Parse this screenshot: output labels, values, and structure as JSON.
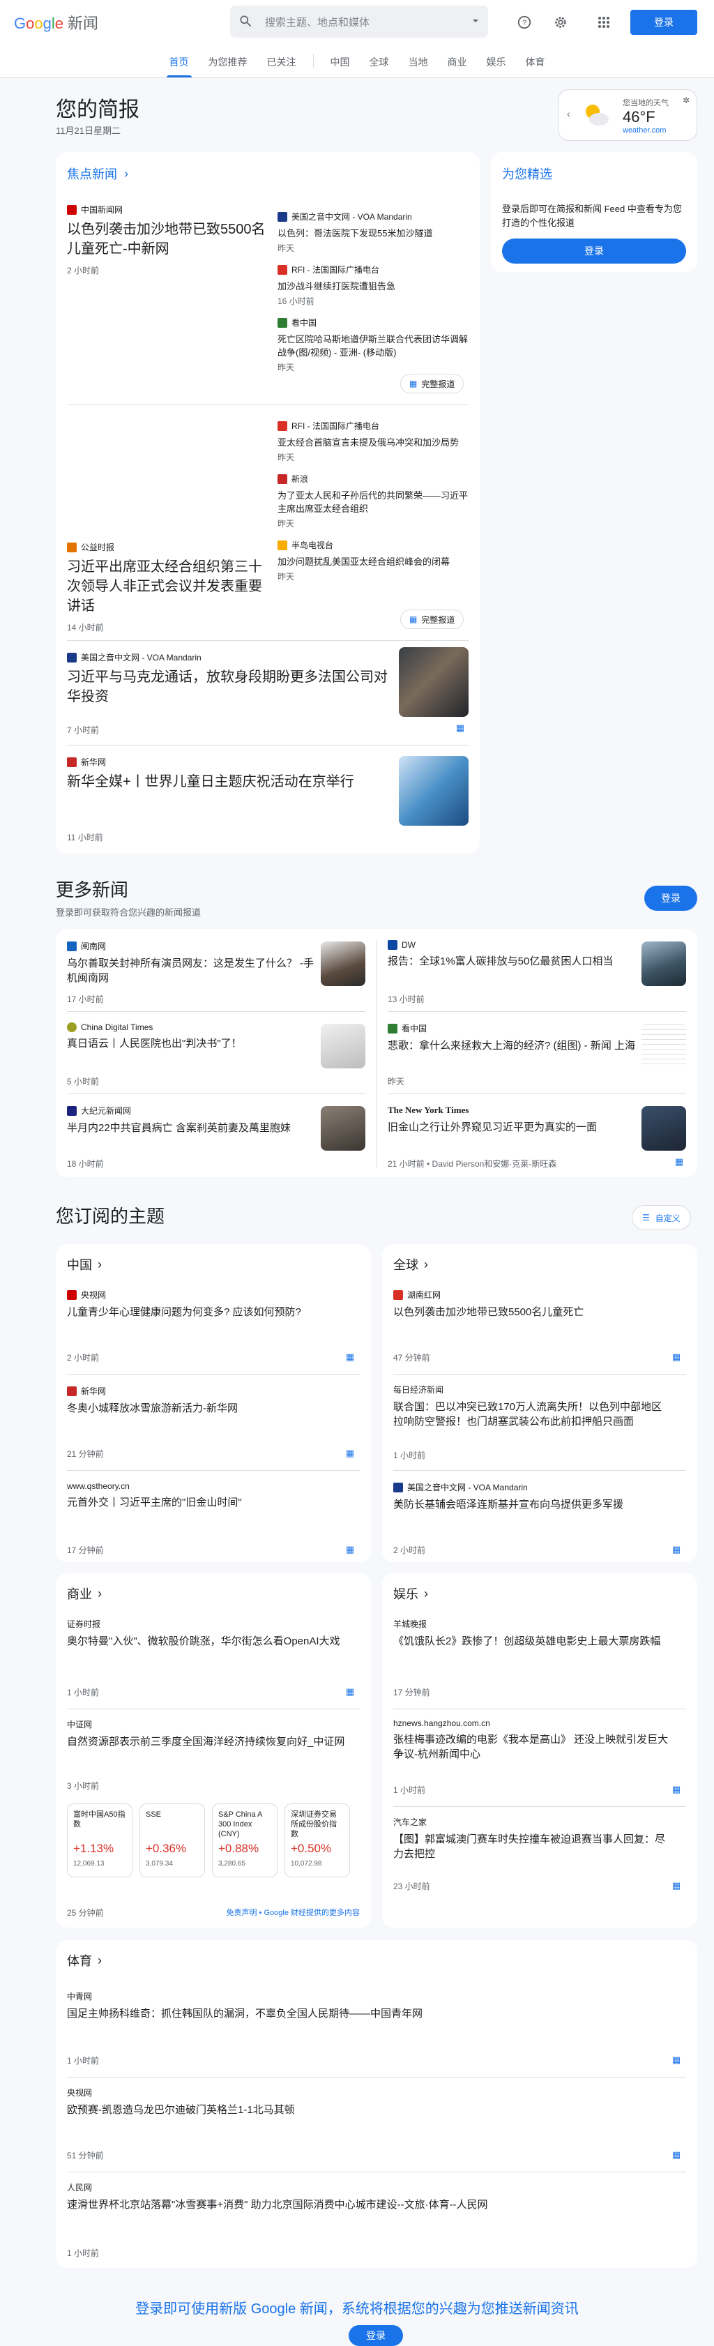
{
  "header": {
    "logo_word": "Google",
    "logo_suffix": "新闻",
    "search_placeholder": "搜索主题、地点和媒体",
    "login": "登录"
  },
  "nav": {
    "tabs": [
      "首页",
      "为您推荐",
      "已关注",
      "中国",
      "全球",
      "当地",
      "商业",
      "娱乐",
      "体育"
    ]
  },
  "briefing": {
    "title": "您的简报",
    "date": "11月21日星期二",
    "weather_label": "您当地的天气",
    "temp": "46°F",
    "weather_src": "weather.com"
  },
  "top": {
    "heading": "焦点新闻",
    "full_coverage": "完整报道",
    "c1": {
      "src": "中国新闻网",
      "title": "以色列袭击加沙地带已致5500名儿童死亡-中新网",
      "time": "2 小时前",
      "side": [
        {
          "src": "美国之音中文网 - VOA Mandarin",
          "title": "以色列：哥法医院下发现55米加沙隧道",
          "time": "昨天"
        },
        {
          "src": "RFI - 法国国际广播电台",
          "title": "加沙战斗继续打医院遭狙告急",
          "time": "16 小时前"
        },
        {
          "src": "看中国",
          "title": "死亡区院哈马斯地道伊斯兰联合代表团访华调解战争(图/视频) - 亚洲- (移动版)",
          "time": "昨天"
        }
      ]
    },
    "c2": {
      "src": "公益时报",
      "title": "习近平出席亚太经合组织第三十次领导人非正式会议并发表重要讲话",
      "time": "14 小时前",
      "side": [
        {
          "src": "RFI - 法国国际广播电台",
          "title": "亚太经合首脑宣言未提及俄乌冲突和加沙局势",
          "time": "昨天"
        },
        {
          "src": "新浪",
          "title": "为了亚太人民和子孙后代的共同繁荣——习近平主席出席亚太经合组织",
          "time": "昨天"
        },
        {
          "src": "半岛电视台",
          "title": "加沙问题扰乱美国亚太经合组织峰会的闭幕",
          "time": "昨天"
        }
      ]
    },
    "c3": {
      "src": "美国之音中文网 - VOA Mandarin",
      "title": "习近平与马克龙通话，放软身段期盼更多法国公司对华投资",
      "time": "7 小时前"
    },
    "c4": {
      "src": "新华网",
      "title": "新华全媒+丨世界儿童日主题庆祝活动在京举行",
      "time": "11 小时前"
    }
  },
  "picks": {
    "heading": "为您精选",
    "text": "登录后即可在简报和新闻 Feed 中查看专为您打造的个性化报道",
    "login": "登录"
  },
  "more": {
    "title": "更多新闻",
    "sub": "登录即可获取符合您兴趣的新闻报道",
    "login": "登录",
    "items": [
      {
        "src": "闽南网",
        "title": "乌尔善取关封神所有演员网友：这是发生了什么？ -手机闽南网",
        "time": "17 小时前"
      },
      {
        "src": "DW",
        "title": "报告：全球1%富人碳排放与50亿最贫困人口相当",
        "time": "13 小时前"
      },
      {
        "src": "China Digital Times",
        "title": "真日语云丨人民医院也出\"判决书\"了！",
        "time": "5 小时前"
      },
      {
        "src": "看中国",
        "title": "悲歌：拿什么来拯救大上海的经济? (组图) - 新闻 上海",
        "time": "昨天"
      },
      {
        "src": "大纪元新闻网",
        "title": "半月内22中共官員病亡 含案刹英前妻及萬里胞妹",
        "time": "18 小时前"
      },
      {
        "src": "The New York Times",
        "title": "旧金山之行让外界窥见习近平更为真实的一面",
        "time": "21 小时前 • David Pierson和安娜·克莱-斯旺森"
      }
    ]
  },
  "topics": {
    "title": "您订阅的主题",
    "customize": "自定义",
    "china": {
      "name": "中国",
      "items": [
        {
          "src": "央视网",
          "title": "儿童青少年心理健康问题为何变多? 应该如何预防?",
          "time": "2 小时前"
        },
        {
          "src": "新华网",
          "title": "冬奥小城释放冰雪旅游新活力-新华网",
          "time": "21 分钟前"
        },
        {
          "src": "www.qstheory.cn",
          "title": "元首外交丨习近平主席的\"旧金山时间\"",
          "time": "17 分钟前"
        }
      ]
    },
    "world": {
      "name": "全球",
      "items": [
        {
          "src": "湖南红网",
          "title": "以色列袭击加沙地带已致5500名儿童死亡",
          "time": "47 分钟前"
        },
        {
          "src": "每日经济新闻",
          "title": "联合国：巴以冲突已致170万人流离失所！以色列中部地区拉响防空警报！也门胡塞武装公布此前扣押船只画面",
          "time": "1 小时前"
        },
        {
          "src": "美国之音中文网 - VOA Mandarin",
          "title": "美防长基辅会晤泽连斯基并宣布向乌提供更多军援",
          "time": "2 小时前"
        }
      ]
    },
    "biz": {
      "name": "商业",
      "items": [
        {
          "src": "证券时报",
          "title": "奥尔特曼\"入伙\"、微软股价跳涨，华尔街怎么看OpenAI大戏",
          "time": "1 小时前"
        },
        {
          "src": "中证网",
          "title": "自然资源部表示前三季度全国海洋经济持续恢复向好_中证网",
          "time": "3 小时前"
        }
      ],
      "stocks": [
        {
          "name": "富时中国A50指数",
          "pct": "+1.13%",
          "val": "12,069.13"
        },
        {
          "name": "SSE",
          "pct": "+0.36%",
          "val": "3,079.34"
        },
        {
          "name": "S&P China A 300 Index (CNY)",
          "pct": "+0.88%",
          "val": "3,280.65"
        },
        {
          "name": "深圳证券交易所成份股价指数",
          "pct": "+0.50%",
          "val": "10,072.98"
        }
      ],
      "stock_time": "25 分钟前",
      "disclaimer": "免责声明 • Google 财经提供的更多内容"
    },
    "ent": {
      "name": "娱乐",
      "items": [
        {
          "src": "羊城晚报",
          "title": "《饥饿队长2》跌惨了！创超级英雄电影史上最大票房跌幅",
          "time": "17 分钟前"
        },
        {
          "src": "hznews.hangzhou.com.cn",
          "title": "张桂梅事迹改编的电影《我本是高山》 还没上映就引发巨大争议-杭州新闻中心",
          "time": "1 小时前"
        },
        {
          "src": "汽车之家",
          "title": "【图】郭富城澳门赛车时失控撞车被迫退赛当事人回复：尽力去把控",
          "time": "23 小时前"
        }
      ]
    },
    "sports": {
      "name": "体育",
      "items": [
        {
          "src": "中青网",
          "title": "国足主帅扬科维奇：抓住韩国队的漏洞，不辜负全国人民期待——中国青年网",
          "time": "1 小时前"
        },
        {
          "src": "央视网",
          "title": "欧预赛-凯恩造乌龙巴尔迪破门英格兰1-1北马其顿",
          "time": "51 分钟前"
        },
        {
          "src": "人民网",
          "title": "速滑世界杯北京站落幕\"冰雪赛事+消费\" 助力北京国际消费中心城市建设--文旅·体育--人民网",
          "time": "1 小时前"
        }
      ]
    }
  },
  "footer": {
    "text": "登录即可使用新版 Google 新闻，系统将根据您的兴趣为您推送新闻资讯",
    "login": "登录"
  },
  "colors": {
    "accent": "#1a73e8",
    "bg": "#f6f8fc",
    "up": "#d93025"
  }
}
